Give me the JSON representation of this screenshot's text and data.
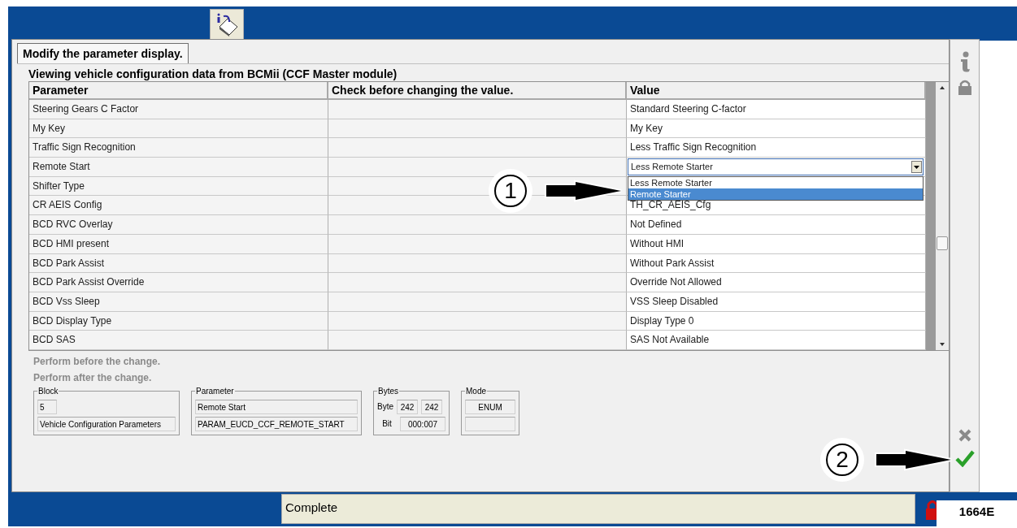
{
  "tab": {
    "label": "Modify the parameter display.",
    "selected": true
  },
  "heading": "Viewing vehicle configuration data from BCMii (CCF Master module)",
  "table": {
    "columns": [
      "Parameter",
      "Check before changing the value.",
      "Value"
    ],
    "rows": [
      {
        "parameter": "Steering Gears C Factor",
        "value": "Standard Steering C-factor",
        "kind": "text"
      },
      {
        "parameter": "My Key",
        "value": "My Key",
        "kind": "text"
      },
      {
        "parameter": "Traffic Sign Recognition",
        "value": "Less Traffic Sign Recognition",
        "kind": "text"
      },
      {
        "parameter": "Remote Start",
        "value": "Less Remote Starter",
        "kind": "combo",
        "expanded": true
      },
      {
        "parameter": "Shifter Type",
        "kind": "text"
      },
      {
        "parameter": "CR AEIS Config",
        "value": "TH_CR_AEIS_Cfg",
        "kind": "text"
      },
      {
        "parameter": "BCD RVC Overlay",
        "value": "Not Defined",
        "kind": "text"
      },
      {
        "parameter": "BCD HMI present",
        "value": "Without HMI",
        "kind": "text"
      },
      {
        "parameter": "BCD Park Assist",
        "value": "Without Park Assist",
        "kind": "text"
      },
      {
        "parameter": "BCD Park Assist Override",
        "value": "Override Not Allowed",
        "kind": "text"
      },
      {
        "parameter": "BCD Vss Sleep",
        "value": "VSS Sleep Disabled",
        "kind": "text"
      },
      {
        "parameter": "BCD Display Type",
        "value": "Display Type 0",
        "kind": "text"
      },
      {
        "parameter": "BCD SAS",
        "value": "SAS Not Available",
        "kind": "text"
      }
    ]
  },
  "dropdown": {
    "options": [
      {
        "label": "Less Remote Starter",
        "selected": false
      },
      {
        "label": "Remote Starter",
        "selected": true
      }
    ]
  },
  "notes": [
    "Perform before the change.",
    "Perform after the change."
  ],
  "groups": {
    "block": {
      "title": "Block",
      "number": "5",
      "name": "Vehicle Configuration Parameters"
    },
    "parameter": {
      "title": "Parameter",
      "name": "Remote Start",
      "id": "PARAM_EUCD_CCF_REMOTE_START"
    },
    "bytes": {
      "title": "Bytes",
      "byte_label": "Byte",
      "byte_from": "242",
      "byte_to": "242",
      "bit_label": "Bit",
      "bit": "000:007"
    },
    "mode": {
      "title": "Mode",
      "value": "ENUM"
    }
  },
  "status_bar": {
    "message": "Complete"
  },
  "callouts": [
    "1",
    "2"
  ],
  "figure_label": "1664E"
}
